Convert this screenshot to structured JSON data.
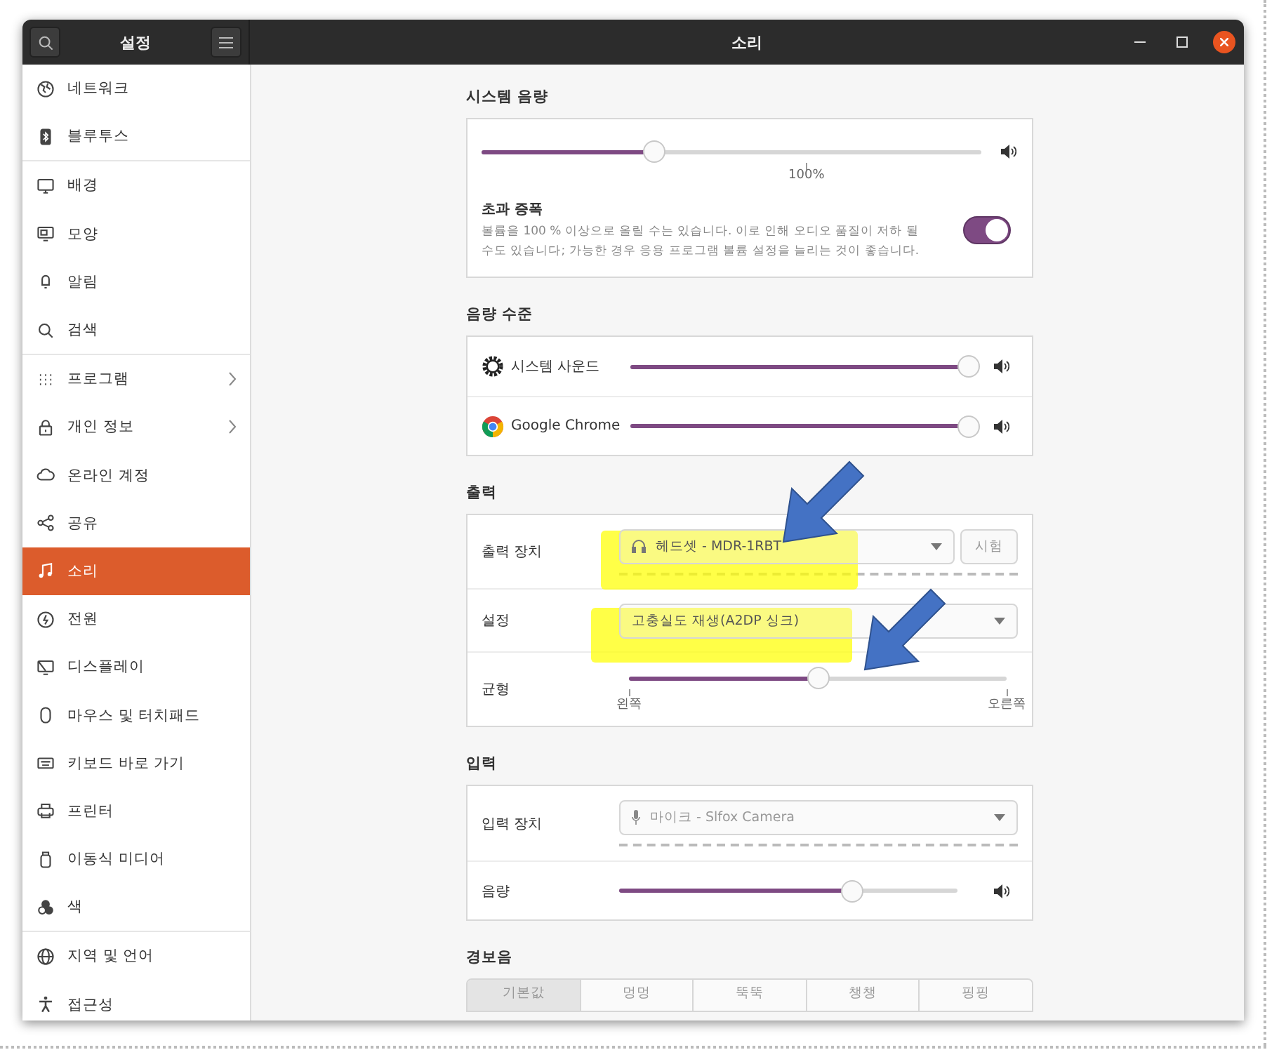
{
  "window": {
    "title": "소리",
    "sidebar_title": "설정"
  },
  "sidebar": {
    "groups": [
      [
        {
          "label": "네트워크",
          "selected": false,
          "chevron": false
        },
        {
          "label": "블루투스",
          "selected": false,
          "chevron": false
        }
      ],
      [
        {
          "label": "배경",
          "selected": false,
          "chevron": false
        },
        {
          "label": "모양",
          "selected": false,
          "chevron": false
        },
        {
          "label": "알림",
          "selected": false,
          "chevron": false
        },
        {
          "label": "검색",
          "selected": false,
          "chevron": false
        }
      ],
      [
        {
          "label": "프로그램",
          "selected": false,
          "chevron": true
        },
        {
          "label": "개인 정보",
          "selected": false,
          "chevron": true
        },
        {
          "label": "온라인 계정",
          "selected": false,
          "chevron": false
        },
        {
          "label": "공유",
          "selected": false,
          "chevron": false
        },
        {
          "label": "소리",
          "selected": true,
          "chevron": false
        },
        {
          "label": "전원",
          "selected": false,
          "chevron": false
        },
        {
          "label": "디스플레이",
          "selected": false,
          "chevron": false
        },
        {
          "label": "마우스 및 터치패드",
          "selected": false,
          "chevron": false
        },
        {
          "label": "키보드 바로 가기",
          "selected": false,
          "chevron": false
        },
        {
          "label": "프린터",
          "selected": false,
          "chevron": false
        },
        {
          "label": "이동식 미디어",
          "selected": false,
          "chevron": false
        },
        {
          "label": "색",
          "selected": false,
          "chevron": false
        }
      ],
      [
        {
          "label": "지역 및 언어",
          "selected": false,
          "chevron": false
        },
        {
          "label": "접근성",
          "selected": false,
          "chevron": false
        }
      ]
    ]
  },
  "system_volume": {
    "title": "시스템 음량",
    "level": 0.345,
    "tick_label": "100%",
    "over_amplification": {
      "label": "초과 증폭",
      "description": "볼륨을 100 % 이상으로 올릴 수는 있습니다. 이로 인해 오디오 품질이 저하 될 수도 있습니다; 가능한 경우 응용 프로그램 볼륨 설정을 늘리는 것이 좋습니다.",
      "on": true
    }
  },
  "volume_levels": {
    "title": "음량 수준",
    "rows": [
      {
        "name": "시스템 사운드",
        "level": 1.0
      },
      {
        "name": "Google Chrome",
        "level": 1.0
      }
    ]
  },
  "output": {
    "title": "출력",
    "device": {
      "label": "출력 장치",
      "value": "헤드셋 - MDR-1RBT"
    },
    "test_button": "시험",
    "profile": {
      "label": "설정",
      "value": "고충실도 재생(A2DP 싱크)"
    },
    "balance": {
      "label": "균형",
      "level": 0.5,
      "left": "왼쪽",
      "right": "오른쪽"
    }
  },
  "input": {
    "title": "입력",
    "device": {
      "label": "입력 장치",
      "value": "마이크 - Slfox Camera"
    },
    "volume": {
      "label": "음량",
      "level": 0.69
    }
  },
  "alert_sound": {
    "title": "경보음",
    "tabs": [
      {
        "label": "기본값",
        "selected": true
      },
      {
        "label": "멍멍",
        "selected": false
      },
      {
        "label": "뚝뚝",
        "selected": false
      },
      {
        "label": "챙챙",
        "selected": false
      },
      {
        "label": "핑핑",
        "selected": false
      }
    ]
  }
}
